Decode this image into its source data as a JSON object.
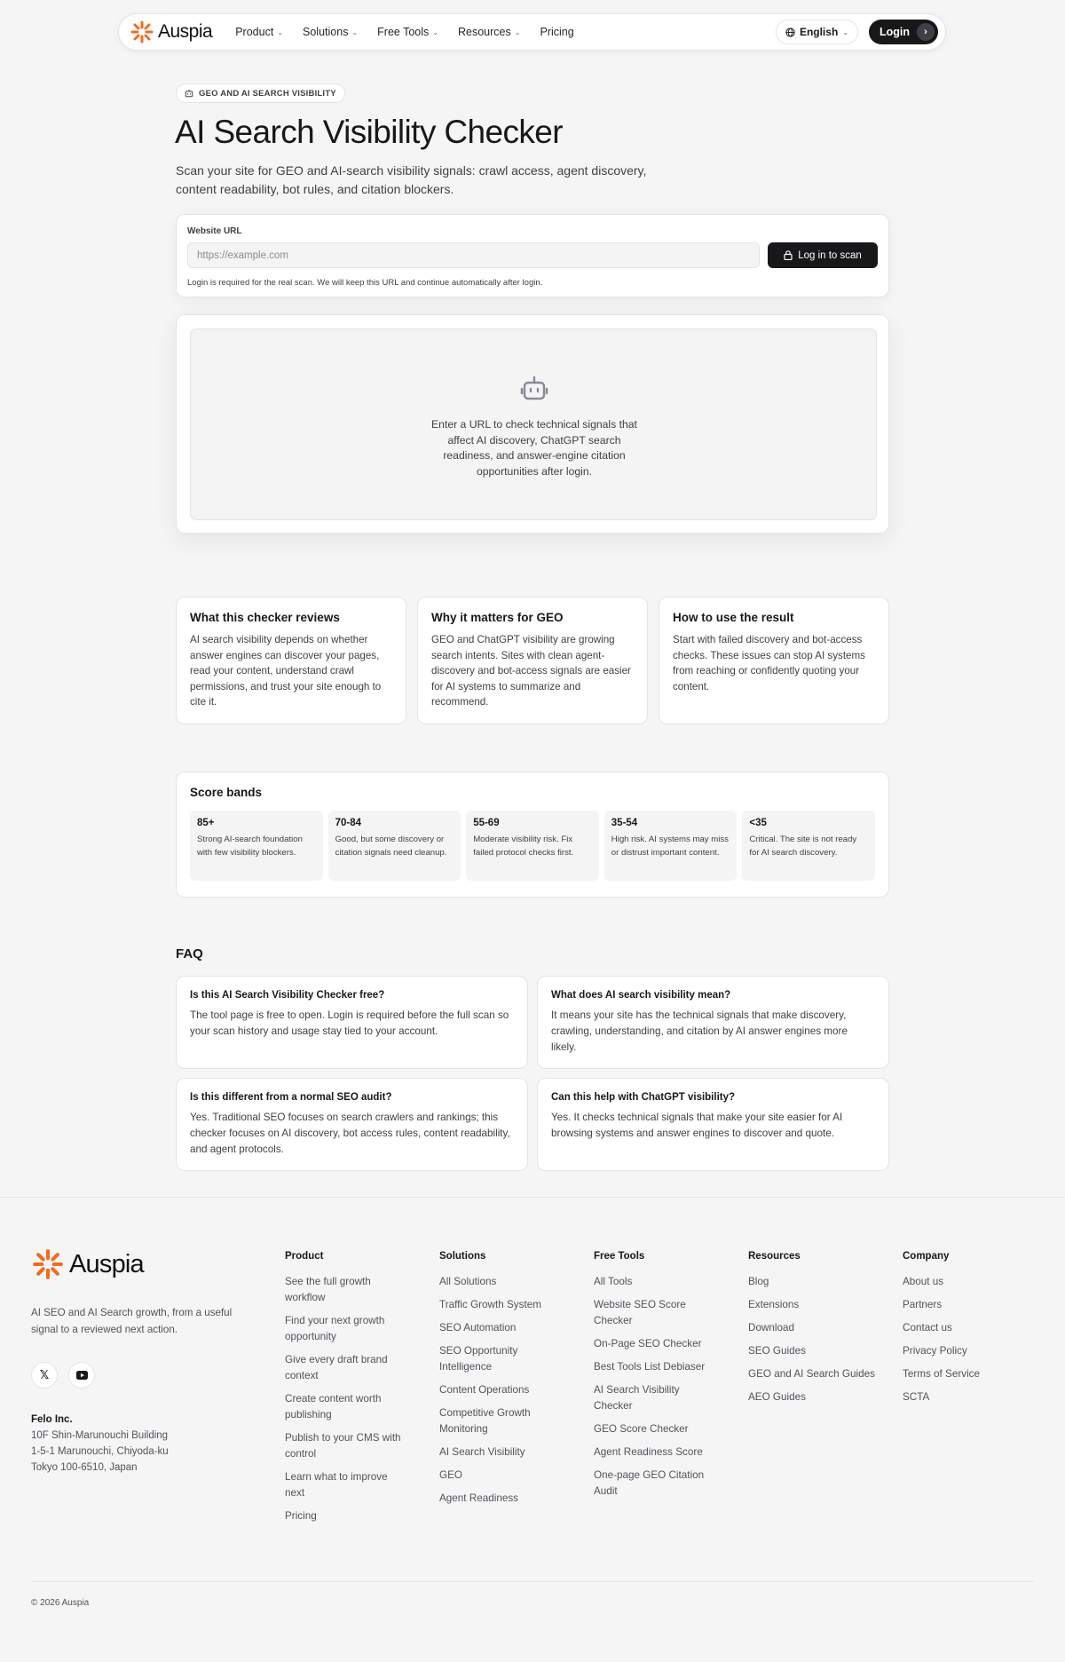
{
  "nav": {
    "brand": "Auspia",
    "links": [
      "Product",
      "Solutions",
      "Free Tools",
      "Resources",
      "Pricing"
    ],
    "language": "English",
    "login": "Login"
  },
  "hero": {
    "badge": "GEO AND AI SEARCH VISIBILITY",
    "title": "AI Search Visibility Checker",
    "subtitle": "Scan your site for GEO and AI-search visibility signals: crawl access, agent discovery, content readability, bot rules, and citation blockers."
  },
  "scan_form": {
    "label": "Website URL",
    "placeholder": "https://example.com",
    "button": "Log in to scan",
    "help": "Login is required for the real scan. We will keep this URL and continue automatically after login."
  },
  "empty_state": {
    "icon": "robot-icon",
    "text": "Enter a URL to check technical signals that affect AI discovery, ChatGPT search readiness, and answer-engine citation opportunities after login."
  },
  "info_cards": [
    {
      "title": "What this checker reviews",
      "body": "AI search visibility depends on whether answer engines can discover your pages, read your content, understand crawl permissions, and trust your site enough to cite it."
    },
    {
      "title": "Why it matters for GEO",
      "body": "GEO and ChatGPT visibility are growing search intents. Sites with clean agent-discovery and bot-access signals are easier for AI systems to summarize and recommend."
    },
    {
      "title": "How to use the result",
      "body": "Start with failed discovery and bot-access checks. These issues can stop AI systems from reaching or confidently quoting your content."
    }
  ],
  "score_bands": {
    "title": "Score bands",
    "bands": [
      {
        "score": "85+",
        "desc": "Strong AI-search foundation with few visibility blockers."
      },
      {
        "score": "70-84",
        "desc": "Good, but some discovery or citation signals need cleanup."
      },
      {
        "score": "55-69",
        "desc": "Moderate visibility risk. Fix failed protocol checks first."
      },
      {
        "score": "35-54",
        "desc": "High risk. AI systems may miss or distrust important content."
      },
      {
        "score": "<35",
        "desc": "Critical. The site is not ready for AI search discovery."
      }
    ]
  },
  "faq": {
    "heading": "FAQ",
    "items": [
      {
        "q": "Is this AI Search Visibility Checker free?",
        "a": "The tool page is free to open. Login is required before the full scan so your scan history and usage stay tied to your account."
      },
      {
        "q": "What does AI search visibility mean?",
        "a": "It means your site has the technical signals that make discovery, crawling, understanding, and citation by AI answer engines more likely."
      },
      {
        "q": "Is this different from a normal SEO audit?",
        "a": "Yes. Traditional SEO focuses on search crawlers and rankings; this checker focuses on AI discovery, bot access rules, content readability, and agent protocols."
      },
      {
        "q": "Can this help with ChatGPT visibility?",
        "a": "Yes. It checks technical signals that make your site easier for AI browsing systems and answer engines to discover and quote."
      }
    ]
  },
  "footer": {
    "brand": "Auspia",
    "tagline": "AI SEO and AI Search growth, from a useful signal to a reviewed next action.",
    "social": [
      "x-icon",
      "youtube-icon"
    ],
    "company_name": "Felo Inc.",
    "address": [
      "10F Shin-Marunouchi Building",
      "1-5-1 Marunouchi, Chiyoda-ku",
      "Tokyo 100-6510, Japan"
    ],
    "columns": [
      {
        "title": "Product",
        "items": [
          "See the full growth workflow",
          "Find your next growth opportunity",
          "Give every draft brand context",
          "Create content worth publishing",
          "Publish to your CMS with control",
          "Learn what to improve next",
          "Pricing"
        ]
      },
      {
        "title": "Solutions",
        "items": [
          "All Solutions",
          "Traffic Growth System",
          "SEO Automation",
          "SEO Opportunity Intelligence",
          "Content Operations",
          "Competitive Growth Monitoring",
          "AI Search Visibility",
          "GEO",
          "Agent Readiness"
        ]
      },
      {
        "title": "Free Tools",
        "items": [
          "All Tools",
          "Website SEO Score Checker",
          "On-Page SEO Checker",
          "Best Tools List Debiaser",
          "AI Search Visibility Checker",
          "GEO Score Checker",
          "Agent Readiness Score",
          "One-page GEO Citation Audit"
        ]
      },
      {
        "title": "Resources",
        "items": [
          "Blog",
          "Extensions",
          "Download",
          "SEO Guides",
          "GEO and AI Search Guides",
          "AEO Guides"
        ]
      },
      {
        "title": "Company",
        "items": [
          "About us",
          "Partners",
          "Contact us",
          "Privacy Policy",
          "Terms of Service",
          "SCTA"
        ]
      }
    ],
    "copyright": "© 2026 Auspia"
  },
  "colors": {
    "brand": "#f26b21",
    "dark": "#18181b",
    "muted": "#52525b",
    "bg": "#f5f5f6"
  }
}
